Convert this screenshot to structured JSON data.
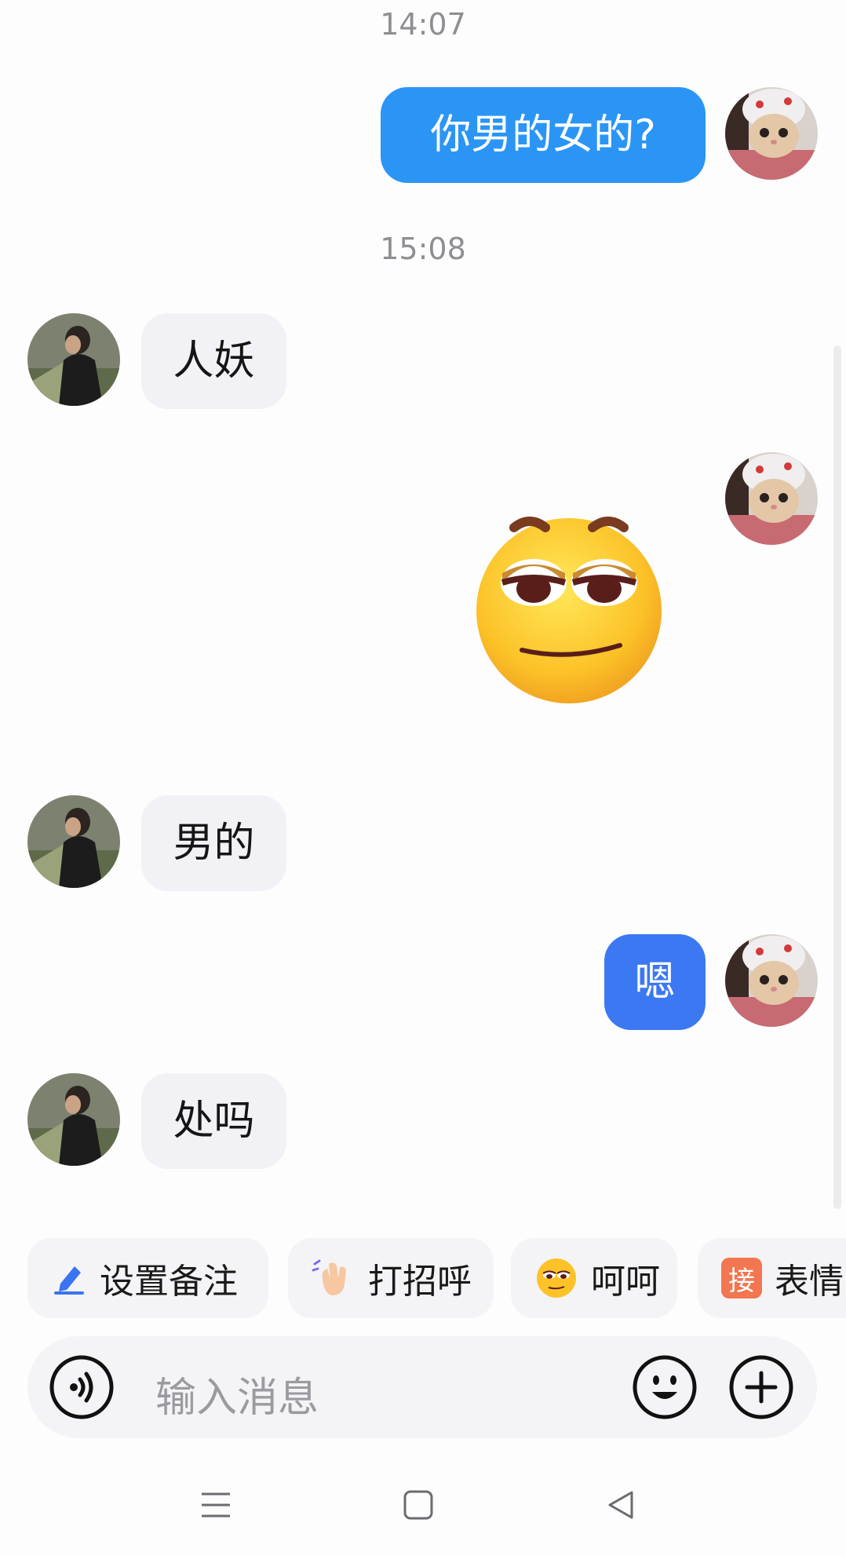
{
  "chat": {
    "timestamps": [
      "14:07",
      "15:08"
    ],
    "messages": [
      {
        "sender": "me",
        "type": "text",
        "text": "你男的女的?"
      },
      {
        "sender": "other",
        "type": "text",
        "text": "人妖"
      },
      {
        "sender": "me",
        "type": "sticker",
        "sticker": "smirk-emoji-sticker"
      },
      {
        "sender": "other",
        "type": "text",
        "text": "男的"
      },
      {
        "sender": "me",
        "type": "text",
        "text": "嗯"
      },
      {
        "sender": "other",
        "type": "text",
        "text": "处吗"
      }
    ]
  },
  "quick_actions": [
    {
      "label": "设置备注",
      "icon": "pencil-icon"
    },
    {
      "label": "打招呼",
      "icon": "wave-hand-icon"
    },
    {
      "label": "呵呵",
      "icon": "smirk-emoji-icon"
    },
    {
      "label": "表情",
      "icon": "jie-badge-icon",
      "icon_text": "接"
    }
  ],
  "input": {
    "placeholder": "输入消息",
    "voice_icon": "voice-icon",
    "emoji_icon": "emoji-icon",
    "plus_icon": "plus-icon"
  },
  "navbar": {
    "menu_icon": "menu-icon",
    "home_icon": "home-square-icon",
    "back_icon": "back-triangle-icon"
  },
  "colors": {
    "sent_bubble": "#2b95f6",
    "sent_bubble_short": "#3b78f2",
    "received_bubble": "#f2f2f6",
    "background": "#fdfdfe",
    "pencil_icon": "#3b74f0",
    "jie_badge": "#f27650"
  }
}
